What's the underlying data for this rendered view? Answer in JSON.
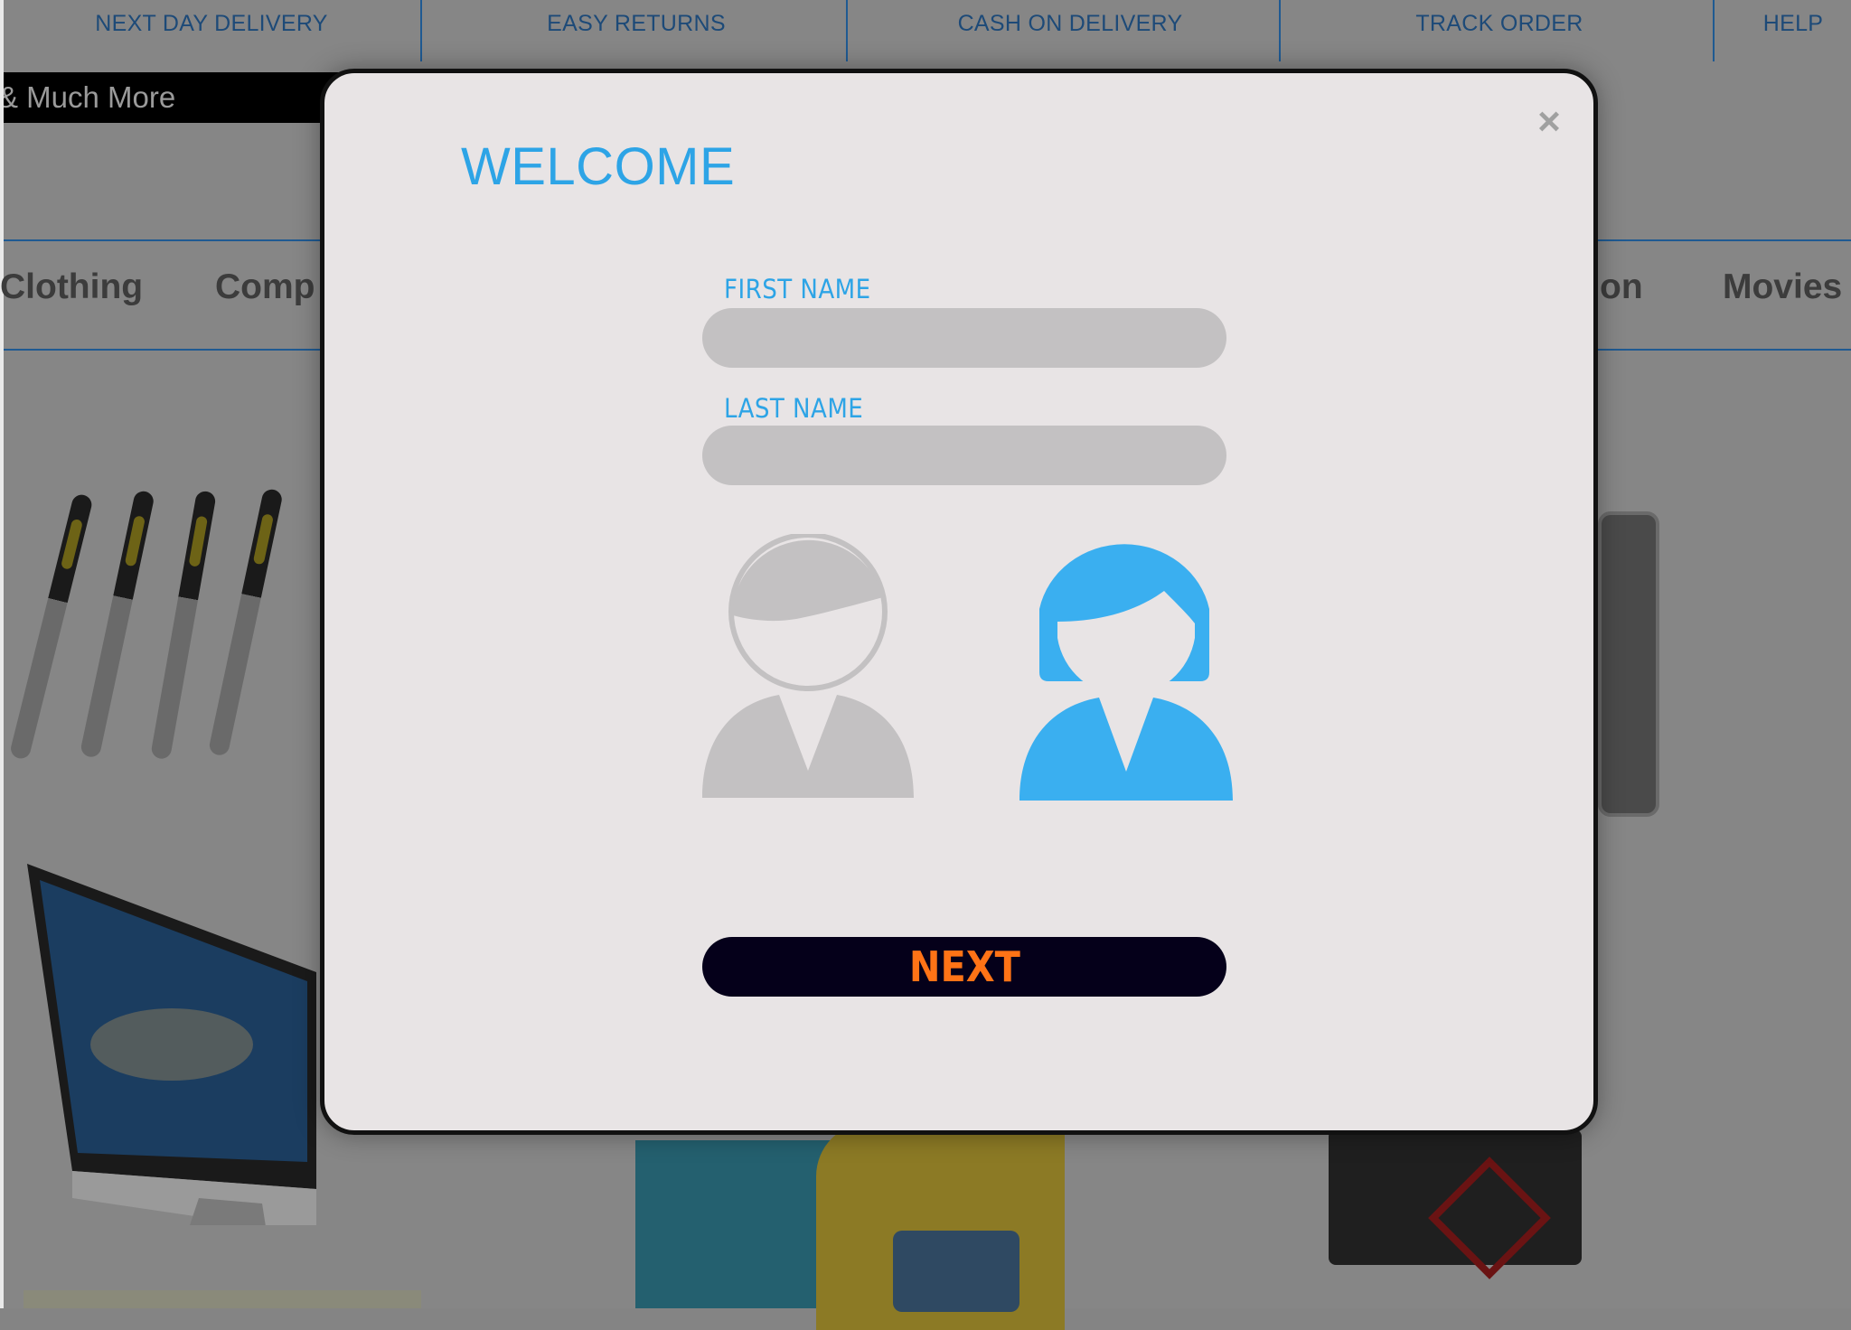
{
  "topbar": {
    "items": [
      "NEXT DAY DELIVERY",
      "EASY RETURNS",
      "CASH ON DELIVERY",
      "TRACK ORDER",
      "HELP"
    ]
  },
  "promo": {
    "text": "& Much More"
  },
  "categories": [
    "Clothing",
    "Comp",
    "on",
    "Movies"
  ],
  "modal": {
    "title": "WELCOME",
    "close_symbol": "×",
    "first_name": {
      "label": "FIRST NAME",
      "value": "",
      "placeholder": ""
    },
    "last_name": {
      "label": "LAST NAME",
      "value": "",
      "placeholder": ""
    },
    "gender_options": [
      {
        "icon": "male-avatar-icon",
        "selected": false,
        "color": "#c3c1c2"
      },
      {
        "icon": "female-avatar-icon",
        "selected": true,
        "color": "#3aaff0"
      }
    ],
    "next_label": "NEXT"
  },
  "colors": {
    "accent_blue": "#2da4e6",
    "next_text": "#ff7316",
    "next_bg": "#05001a",
    "overlay": "#868686"
  }
}
